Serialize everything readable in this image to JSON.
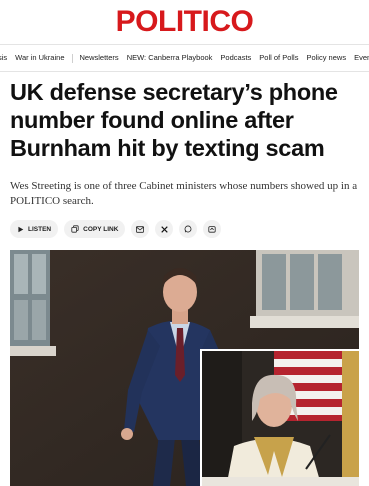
{
  "brand": {
    "name": "POLITICO",
    "color": "#d7191c"
  },
  "nav": {
    "items": [
      "sis",
      "War in Ukraine",
      "Newsletters",
      "NEW: Canberra Playbook",
      "Podcasts",
      "Poll of Polls",
      "Policy news",
      "Events"
    ]
  },
  "article": {
    "headline": "UK defense secretary’s phone number found online after Burnham hit by texting scam",
    "dek": "Wes Streeting is one of three Cabinet ministers whose numbers showed up in a POLITICO search."
  },
  "actions": {
    "listen_label": "LISTEN",
    "copy_link_label": "COPY LINK",
    "share_icons": [
      "email-icon",
      "x-icon",
      "whatsapp-icon",
      "share-icon"
    ]
  },
  "images": {
    "main": "man-in-suit-walking-photo",
    "inset": "woman-speaking-at-podium-photo"
  }
}
